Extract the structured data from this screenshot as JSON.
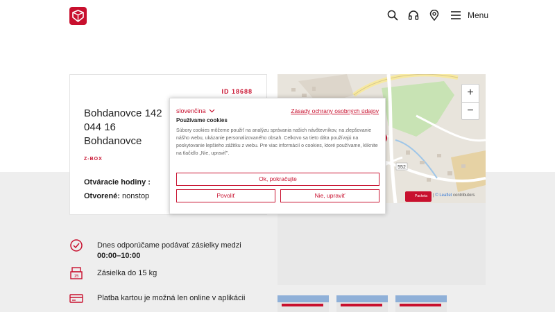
{
  "header": {
    "menu_label": "Menu",
    "icons": [
      "search-icon",
      "headset-icon",
      "location-pin-icon",
      "hamburger-icon"
    ],
    "brand_color": "#c8102e"
  },
  "box": {
    "id_label": "ID 18688",
    "address_line1": "Bohdanovce 142",
    "address_line2": "044 16",
    "address_line3": "Bohdanovce",
    "type": "Z-BOX",
    "hours_label": "Otváracie hodiny :",
    "open_label": "Otvorené:",
    "open_value": "nonstop"
  },
  "map": {
    "zoom_in": "+",
    "zoom_out": "−",
    "road_label": "552",
    "badge_label": "Packeta",
    "attribution_sep": "|",
    "attribution_link": "© Leaflet",
    "attribution_text": "contributors"
  },
  "info": {
    "recommend_prefix": "Dnes odporúčame podávať zásielky medzi ",
    "recommend_time": "00:00–10:00",
    "weight": "Zásielka do 15 kg",
    "weight_icon_label": "15",
    "payment": "Platba kartou je možná len online v aplikácii"
  },
  "cookie": {
    "language": "slovenčina",
    "privacy_link": "Zásady ochrany osobných údajov",
    "title": "Používame cookies",
    "text": "Súbory cookies môžeme použiť na analýzu správania našich návštevníkov, na zlepšovanie nášho webu, ukázanie personalizovaného obsah. Celkovo sa tieto dáta používajú na poskytovanie lepšieho zážitku z webu. Pre viac informácií o cookies, ktoré používame, kliknite na tlačidlo „Nie, upraviť\".",
    "ok_button": "Ok, pokračujte",
    "allow_button": "Povoliť",
    "no_button": "Nie, upraviť"
  }
}
